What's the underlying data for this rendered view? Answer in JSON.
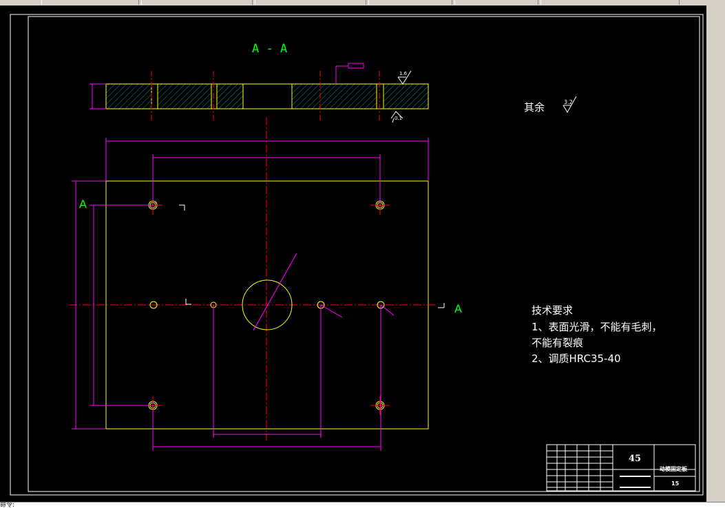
{
  "section_label": "A - A",
  "section_marker": "A",
  "surface_note": "其余",
  "surface_rough_main": "3.2",
  "surface_rough_small_1": "1.6",
  "surface_rough_small_2": "0.1",
  "tech_requirements": {
    "title": "技术要求",
    "line1": "1、表面光滑，不能有毛刺，",
    "line2": "不能有裂痕",
    "line3": "2、调质HRC35-40"
  },
  "title_block": {
    "material": "45",
    "part_name": "动模固定板",
    "number": "15"
  },
  "command_line": "命令:",
  "colors": {
    "outline": "#ffff00",
    "dimension": "#ff00ff",
    "centerline": "#ff0000",
    "text": "#ffffff",
    "section_text": "#00ff00",
    "hatch": "#00c0c0",
    "frame": "#ffffff"
  }
}
